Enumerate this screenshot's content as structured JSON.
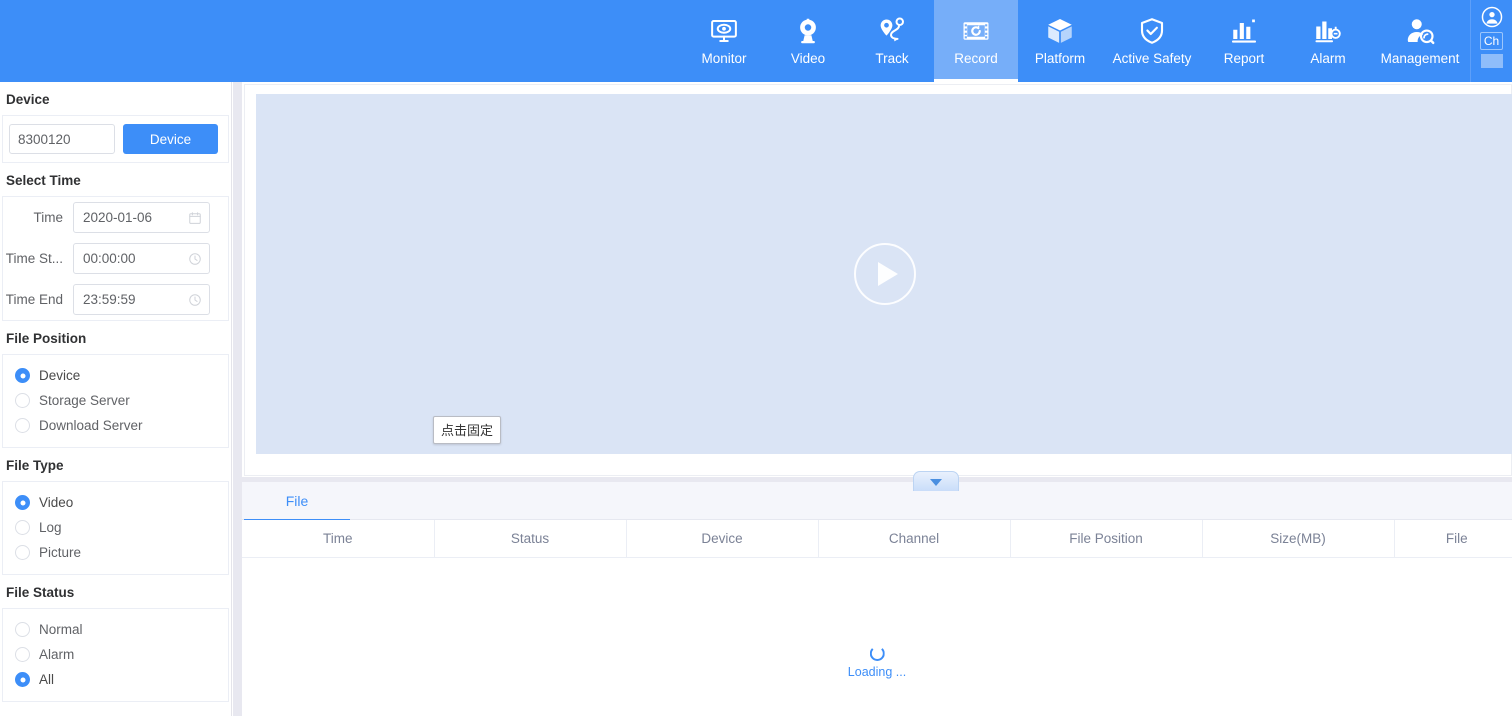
{
  "header": {
    "nav": [
      {
        "label": "Monitor",
        "icon": "monitor-icon",
        "active": false
      },
      {
        "label": "Video",
        "icon": "camera-icon",
        "active": false
      },
      {
        "label": "Track",
        "icon": "track-icon",
        "active": false
      },
      {
        "label": "Record",
        "icon": "film-replay-icon",
        "active": true
      },
      {
        "label": "Platform",
        "icon": "cube-icon",
        "active": false
      },
      {
        "label": "Active Safety",
        "icon": "shield-check-icon",
        "active": false
      },
      {
        "label": "Report",
        "icon": "bar-chart-icon",
        "active": false
      },
      {
        "label": "Alarm",
        "icon": "alarm-bell-icon",
        "active": false
      },
      {
        "label": "Management",
        "icon": "user-search-icon",
        "active": false
      }
    ],
    "user_icon": "user-circle-icon",
    "partial_label": "Ch"
  },
  "sidebar": {
    "device_section": {
      "title": "Device",
      "input_value": "8300120",
      "input_placeholder": "8300120",
      "button_label": "Device"
    },
    "time_section": {
      "title": "Select Time",
      "rows": [
        {
          "label": "Time",
          "value": "2020-01-06",
          "icon": "calendar-icon"
        },
        {
          "label": "Time St...",
          "value": "00:00:00",
          "icon": "clock-icon"
        },
        {
          "label": "Time End",
          "value": "23:59:59",
          "icon": "clock-icon"
        }
      ]
    },
    "file_position": {
      "title": "File Position",
      "options": [
        {
          "label": "Device",
          "selected": true
        },
        {
          "label": "Storage Server",
          "selected": false
        },
        {
          "label": "Download Server",
          "selected": false
        }
      ]
    },
    "file_type": {
      "title": "File Type",
      "options": [
        {
          "label": "Video",
          "selected": true
        },
        {
          "label": "Log",
          "selected": false
        },
        {
          "label": "Picture",
          "selected": false
        }
      ]
    },
    "file_status": {
      "title": "File Status",
      "options": [
        {
          "label": "Normal",
          "selected": false
        },
        {
          "label": "Alarm",
          "selected": false
        },
        {
          "label": "All",
          "selected": true
        }
      ]
    }
  },
  "main": {
    "video": {
      "play_icon": "play-circle-icon",
      "pin_tooltip": "点击固定",
      "collapse_icon": "chevron-down-icon"
    },
    "tabs": [
      {
        "label": "File",
        "active": true
      }
    ],
    "table": {
      "columns": [
        "Time",
        "Status",
        "Device",
        "Channel",
        "File Position",
        "Size(MB)",
        "File"
      ],
      "rows": [],
      "loading_text": "Loading ..."
    }
  },
  "colors": {
    "brand_blue": "#3d8ef8",
    "active_tab_blue": "#76aef9",
    "video_bg": "#dae4f5",
    "gap_bg": "#e8e8f0"
  }
}
